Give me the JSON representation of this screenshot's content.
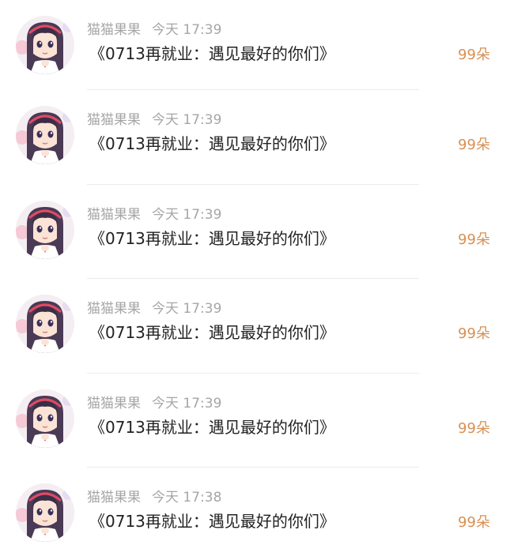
{
  "records": [
    {
      "username": "猫猫果果",
      "time": "今天 17:39",
      "title": "《0713再就业：遇见最好的你们》",
      "count": "99朵",
      "avatar": "anime-girl-avatar"
    },
    {
      "username": "猫猫果果",
      "time": "今天 17:39",
      "title": "《0713再就业：遇见最好的你们》",
      "count": "99朵",
      "avatar": "anime-girl-avatar"
    },
    {
      "username": "猫猫果果",
      "time": "今天 17:39",
      "title": "《0713再就业：遇见最好的你们》",
      "count": "99朵",
      "avatar": "anime-girl-avatar"
    },
    {
      "username": "猫猫果果",
      "time": "今天 17:39",
      "title": "《0713再就业：遇见最好的你们》",
      "count": "99朵",
      "avatar": "anime-girl-avatar"
    },
    {
      "username": "猫猫果果",
      "time": "今天 17:39",
      "title": "《0713再就业：遇见最好的你们》",
      "count": "99朵",
      "avatar": "anime-girl-avatar"
    },
    {
      "username": "猫猫果果",
      "time": "今天 17:38",
      "title": "《0713再就业：遇见最好的你们》",
      "count": "99朵",
      "avatar": "anime-girl-avatar"
    }
  ],
  "colors": {
    "count": "#d79054",
    "meta": "#a6a6a6",
    "title": "#222222",
    "divider": "#ececec"
  }
}
